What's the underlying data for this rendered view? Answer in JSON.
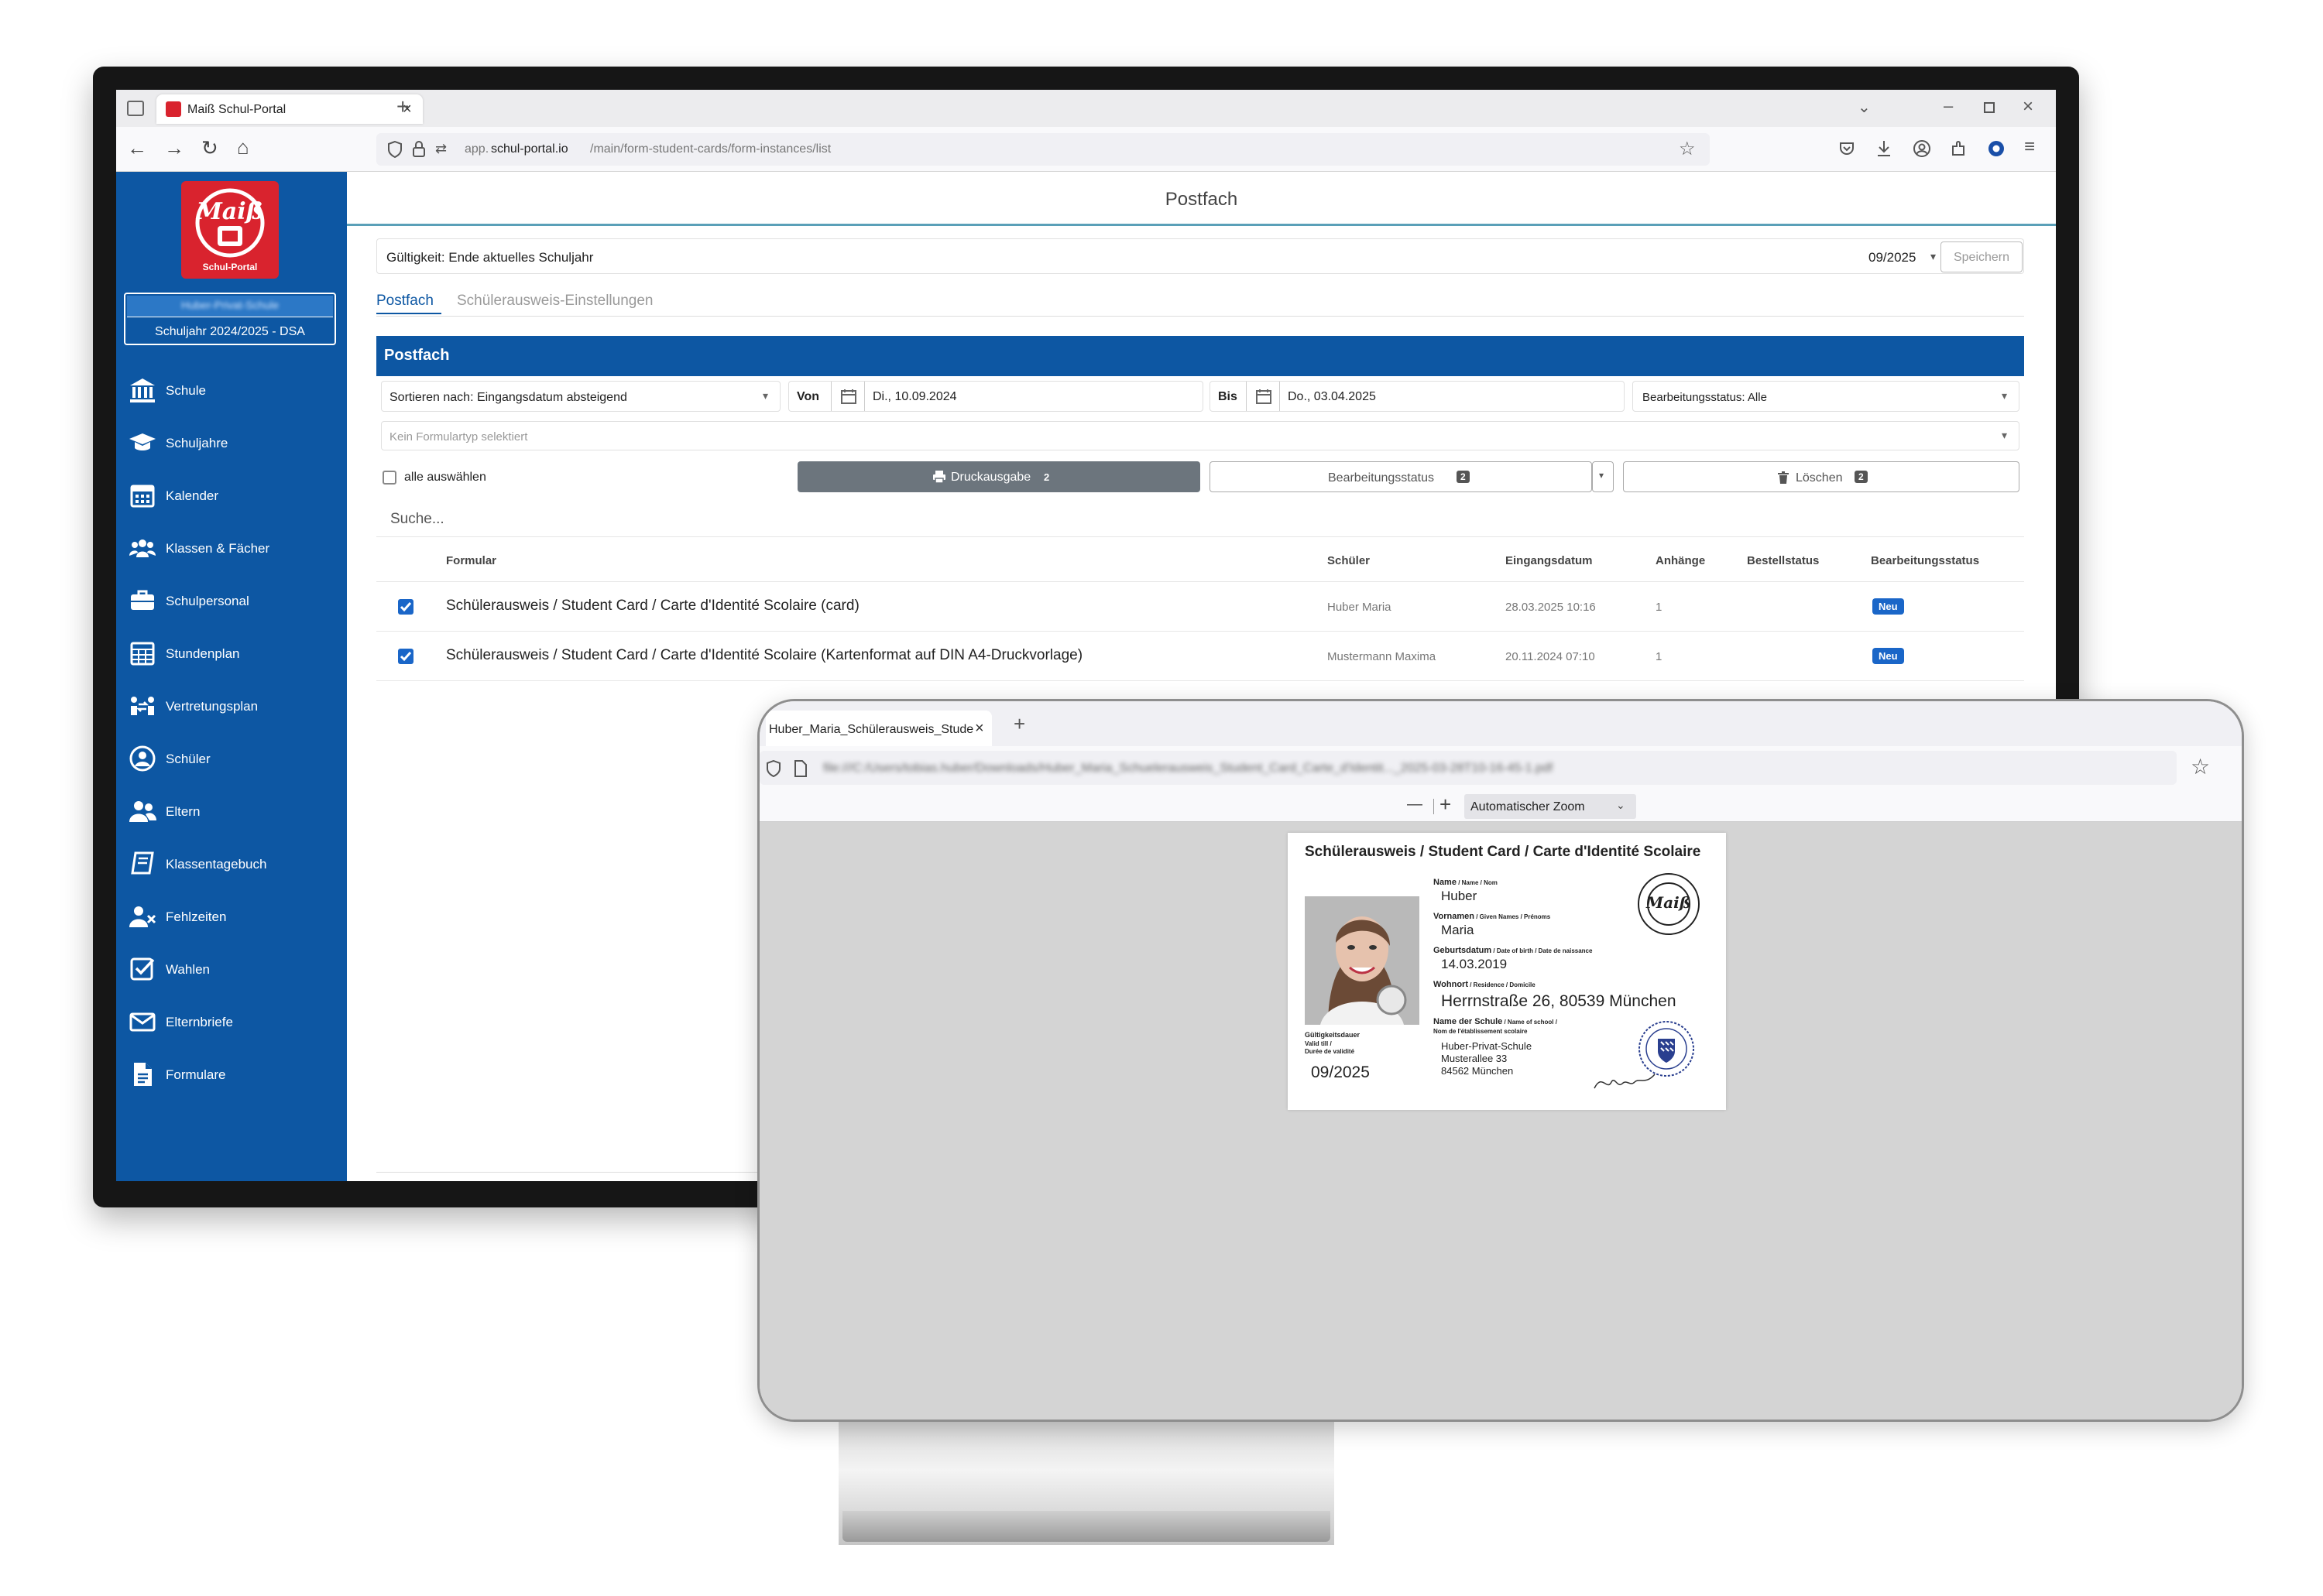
{
  "browser1": {
    "tab_title": "Maiß Schul-Portal",
    "url_prefix": "app.",
    "url_domain": "schul-portal.io",
    "url_path": "/main/form-student-cards/form-instances/list",
    "new_tab": "+"
  },
  "sidebar": {
    "logo_text": "Maiß",
    "logo_sub": "Schul-Portal",
    "school_name_blurred": "Huber-Privat-Schule",
    "school_year": "Schuljahr 2024/2025 - DSA",
    "items": [
      {
        "label": "Schule",
        "icon": "bank-icon"
      },
      {
        "label": "Schuljahre",
        "icon": "graduation-cap-icon"
      },
      {
        "label": "Kalender",
        "icon": "calendar-icon"
      },
      {
        "label": "Klassen & Fächer",
        "icon": "users-icon"
      },
      {
        "label": "Schulpersonal",
        "icon": "briefcase-icon"
      },
      {
        "label": "Stundenplan",
        "icon": "timetable-icon"
      },
      {
        "label": "Vertretungsplan",
        "icon": "substitution-icon"
      },
      {
        "label": "Schüler",
        "icon": "user-circle-icon"
      },
      {
        "label": "Eltern",
        "icon": "parents-icon"
      },
      {
        "label": "Klassentagebuch",
        "icon": "book-icon"
      },
      {
        "label": "Fehlzeiten",
        "icon": "user-x-icon"
      },
      {
        "label": "Wahlen",
        "icon": "checkbox-icon"
      },
      {
        "label": "Elternbriefe",
        "icon": "envelope-icon"
      },
      {
        "label": "Formulare",
        "icon": "document-icon"
      }
    ]
  },
  "page": {
    "title": "Postfach",
    "validity_label": "Gültigkeit: Ende aktuelles Schuljahr",
    "validity_value": "09/2025",
    "save_label": "Speichern",
    "tabs": [
      "Postfach",
      "Schülerausweis-Einstellungen"
    ],
    "panel_title": "Postfach"
  },
  "filters": {
    "sort_label": "Sortieren nach: Eingangsdatum absteigend",
    "from_label": "Von",
    "from_value": "Di., 10.09.2024",
    "to_label": "Bis",
    "to_value": "Do., 03.04.2025",
    "status_label": "Bearbeitungsstatus: Alle",
    "formtype_placeholder": "Kein Formulartyp selektiert",
    "select_all_label": "alle auswählen",
    "print_label": "Druckausgabe",
    "print_count": "2",
    "status_btn_label": "Bearbeitungsstatus",
    "status_btn_count": "2",
    "delete_label": "Löschen",
    "delete_count": "2",
    "search_placeholder": "Suche..."
  },
  "table": {
    "headers": [
      "Formular",
      "Schüler",
      "Eingangsdatum",
      "Anhänge",
      "Bestellstatus",
      "Bearbeitungsstatus"
    ],
    "rows": [
      {
        "form": "Schülerausweis / Student Card / Carte d'Identité Scolaire (card)",
        "student": "Huber Maria",
        "date": "28.03.2025 10:16",
        "attachments": "1",
        "order": "",
        "status": "Neu",
        "checked": true
      },
      {
        "form": "Schülerausweis / Student Card / Carte d'Identité Scolaire (Kartenformat auf DIN A4-Druckvorlage)",
        "student": "Mustermann Maxima",
        "date": "20.11.2024 07:10",
        "attachments": "1",
        "order": "",
        "status": "Neu",
        "checked": true
      }
    ]
  },
  "pager": {
    "first": "«",
    "prev": "‹"
  },
  "browser2": {
    "tab_title": "Huber_Maria_Schülerausweis_Stude",
    "tab_close": "×",
    "new_tab": "+",
    "url_blurred": "file:///C:/Users/tobias.huber/Downloads/Huber_Maria_Schuelerausweis_Student_Card_Carte_d'Identit..._2025-03-28T10-16-45-1.pdf",
    "zoom_minus": "—",
    "zoom_plus": "+",
    "zoom_label": "Automatischer Zoom"
  },
  "card": {
    "title": "Schülerausweis / Student Card / Carte d'Identité Scolaire",
    "name_label": "Name",
    "name_label_sub": " / Name / Nom",
    "name_value": "Huber",
    "given_label": "Vornamen",
    "given_label_sub": " / Given Names / Prénoms",
    "given_value": "Maria",
    "birth_label": "Geburtsdatum",
    "birth_label_sub": " / Date of birth / Date de naissance",
    "birth_value": "14.03.2019",
    "residence_label": "Wohnort",
    "residence_label_sub": " / Residence / Domicile",
    "residence_value": "Herrnstraße 26, 80539 München",
    "school_label": "Name der Schule",
    "school_label_sub": " / Name of school /",
    "school_label_sub2": "Nom de l'établissement scolaire",
    "school_line1": "Huber-Privat-Schule",
    "school_line2": "Musterallee 33",
    "school_line3": "84562 München",
    "validity_label": "Gültigkeitsdauer",
    "validity_sub1": "Valid till /",
    "validity_sub2": "Durée de validité",
    "validity_value": "09/2025",
    "stamp_text": "Maiß",
    "signature": "Dan. gebr"
  },
  "colors": {
    "brand_blue": "#0d57a3",
    "badge_blue": "#1a66c8",
    "logo_red": "#d9232e",
    "button_gray": "#6c757d"
  }
}
